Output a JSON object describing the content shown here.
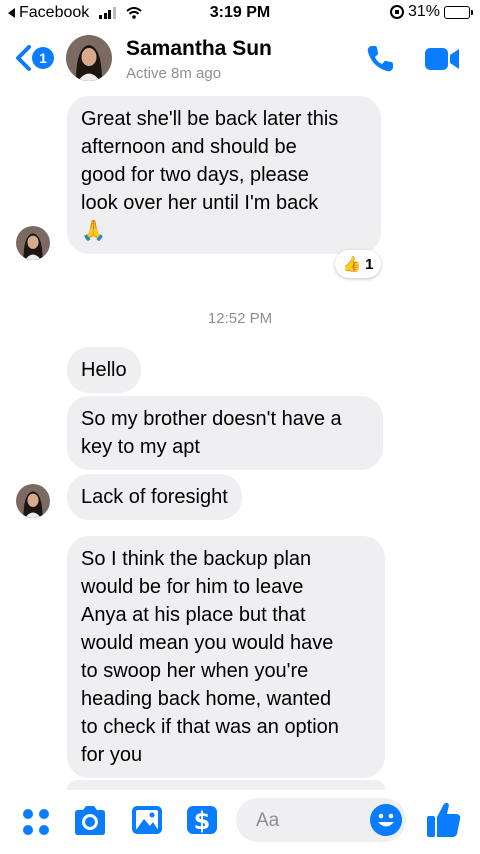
{
  "status_bar": {
    "back_app": "Facebook",
    "time": "3:19 PM",
    "battery_percent": "31%",
    "battery_level": 0.31
  },
  "header": {
    "back_badge_count": "1",
    "contact_name": "Samantha Sun",
    "contact_status": "Active 8m ago"
  },
  "messages": [
    {
      "text": "Great she'll be back later this\nafternoon and should be\ngood for two days, please\nlook over her until I'm back\n🙏"
    },
    {
      "text": "Hello"
    },
    {
      "text": "So my brother doesn't have a\nkey to my apt"
    },
    {
      "text": "Lack of foresight"
    },
    {
      "text": "So I think the backup plan\nwould be for him to leave\nAnya at his place but that\nwould mean you would have\nto swoop her when you're\nheading back home, wanted\nto check if that was an option\nfor you"
    }
  ],
  "reaction": {
    "emoji": "👍",
    "count": "1"
  },
  "timestamp": "12:52 PM",
  "composer": {
    "placeholder": "Aa"
  },
  "colors": {
    "accent": "#0a7cff",
    "bubble": "#efeff1",
    "muted": "#8e8e93"
  },
  "icons": [
    "back-chevron-icon",
    "phone-icon",
    "video-icon",
    "menu-dots-icon",
    "camera-icon",
    "photo-icon",
    "dollar-icon",
    "emoji-icon",
    "thumbs-up-icon"
  ]
}
